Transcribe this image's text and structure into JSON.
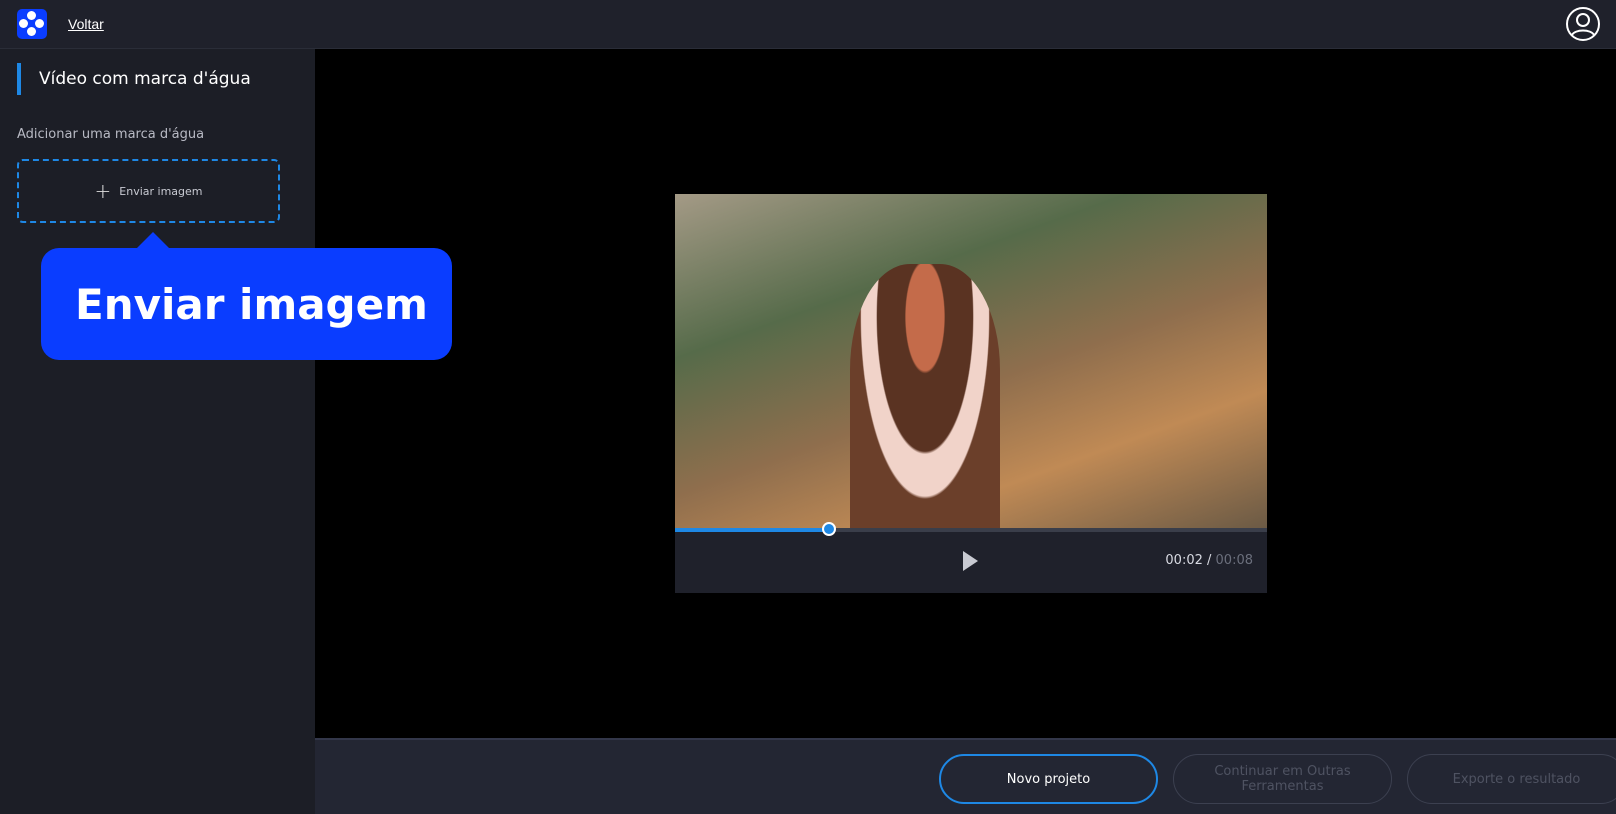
{
  "header": {
    "back_label": "Voltar"
  },
  "sidebar": {
    "title": "Vídeo com marca d'água",
    "subtitle": "Adicionar uma marca d'água",
    "upload_label": "Enviar imagem"
  },
  "tooltip": {
    "text": "Enviar imagem"
  },
  "player": {
    "current_time": "00:02",
    "total_time": "00:08",
    "progress_fraction": 0.26
  },
  "footer": {
    "new_project": "Novo projeto",
    "continue": "Continuar em Outras Ferramentas",
    "export": "Exporte o resultado"
  },
  "colors": {
    "accent": "#1e88e5",
    "brand": "#0a3dff"
  }
}
